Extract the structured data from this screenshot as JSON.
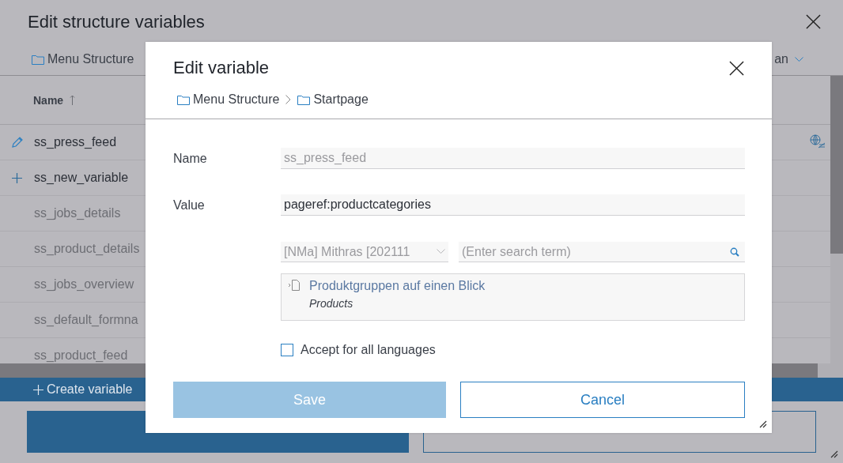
{
  "window": {
    "title": "Edit structure variables"
  },
  "breadcrumb": [
    {
      "label": "Menu Structure"
    }
  ],
  "language": {
    "label": "an"
  },
  "table": {
    "columns": [
      {
        "label": "Name",
        "sorted_ascending": true
      }
    ],
    "rows": [
      {
        "name": "ss_press_feed",
        "kind": "edited"
      },
      {
        "name": "ss_new_variable",
        "kind": "new"
      },
      {
        "name": "ss_jobs_details",
        "kind": "plain"
      },
      {
        "name": "ss_product_details",
        "kind": "plain"
      },
      {
        "name": "ss_jobs_overview",
        "kind": "plain"
      },
      {
        "name": "ss_default_formna",
        "kind": "plain"
      },
      {
        "name": "ss_product_feed",
        "kind": "plain"
      }
    ]
  },
  "create_button": {
    "label": "Create variable"
  },
  "footer_buttons": [
    {
      "kind": "primary"
    },
    {
      "kind": "secondary"
    }
  ],
  "dialog": {
    "title": "Edit variable",
    "breadcrumb": [
      {
        "label": "Menu Structure"
      },
      {
        "label": "Startpage"
      }
    ],
    "fields": [
      {
        "label": "Name",
        "value": "ss_press_feed",
        "disabled": true
      },
      {
        "label": "Value",
        "value": "pageref:productcategories",
        "disabled": false
      }
    ],
    "project_select": {
      "value": "[NMa] Mithras [202111"
    },
    "search": {
      "placeholder": "(Enter search term)"
    },
    "result": {
      "title": "Produktgruppen auf einen Blick",
      "subtitle": "Products"
    },
    "checkbox": {
      "label": "Accept for all languages",
      "checked": false
    },
    "buttons": [
      {
        "label": "Save",
        "kind": "primary",
        "disabled": true
      },
      {
        "label": "Cancel",
        "kind": "secondary",
        "disabled": false
      }
    ]
  }
}
